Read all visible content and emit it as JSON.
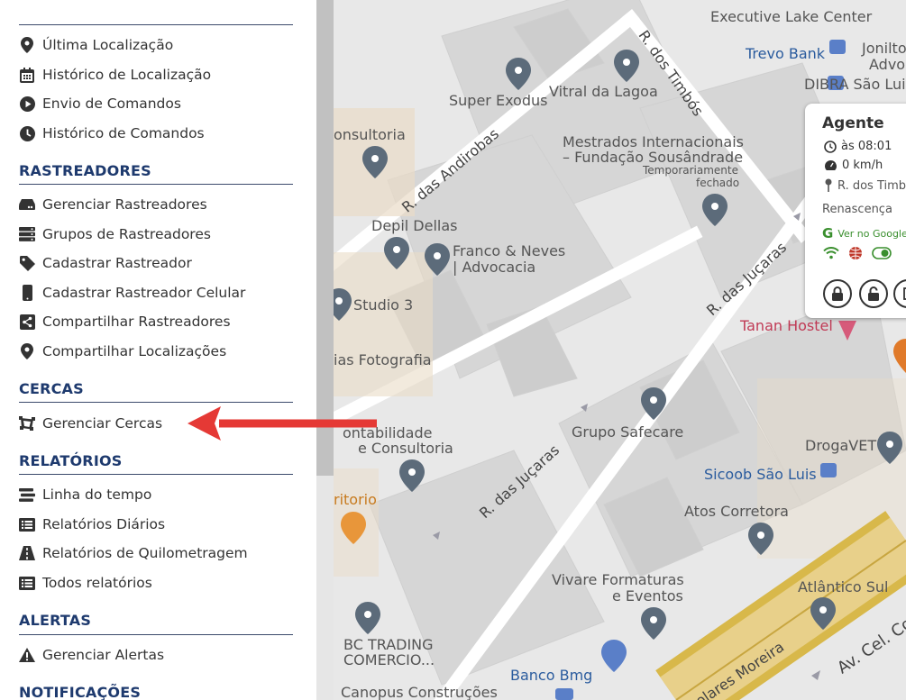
{
  "sidebar": {
    "top_items": [
      {
        "label": "Última Localização",
        "icon": "map-marker-icon"
      },
      {
        "label": "Histórico de Localização",
        "icon": "calendar-icon"
      },
      {
        "label": "Envio de Comandos",
        "icon": "play-circle-icon"
      },
      {
        "label": "Histórico de Comandos",
        "icon": "clock-icon"
      }
    ],
    "sections": [
      {
        "title": "RASTREADORES",
        "items": [
          {
            "label": "Gerenciar Rastreadores",
            "icon": "hdd-icon"
          },
          {
            "label": "Grupos de Rastreadores",
            "icon": "server-icon"
          },
          {
            "label": "Cadastrar Rastreador",
            "icon": "tag-icon"
          },
          {
            "label": "Cadastrar Rastreador Celular",
            "icon": "mobile-icon"
          },
          {
            "label": "Compartilhar Rastreadores",
            "icon": "share-icon"
          },
          {
            "label": "Compartilhar Localizações",
            "icon": "map-marker-icon"
          }
        ]
      },
      {
        "title": "CERCAS",
        "items": [
          {
            "label": "Gerenciar Cercas",
            "icon": "draw-polygon-icon"
          }
        ]
      },
      {
        "title": "RELATÓRIOS",
        "items": [
          {
            "label": "Linha do tempo",
            "icon": "stream-icon"
          },
          {
            "label": "Relatórios Diários",
            "icon": "list-alt-icon"
          },
          {
            "label": "Relatórios de Quilometragem",
            "icon": "road-icon"
          },
          {
            "label": "Todos relatórios",
            "icon": "list-alt-icon"
          }
        ]
      },
      {
        "title": "ALERTAS",
        "items": [
          {
            "label": "Gerenciar Alertas",
            "icon": "warning-icon"
          }
        ]
      },
      {
        "title": "NOTIFICAÇÕES",
        "items": []
      }
    ]
  },
  "map": {
    "places": [
      {
        "name": "Executive Lake Center",
        "style": "gray"
      },
      {
        "name": "Trevo Bank",
        "style": "blue"
      },
      {
        "name": "Jonilto",
        "style": "gray"
      },
      {
        "name": "Advog",
        "style": "gray"
      },
      {
        "name": "DIBRA São Luis",
        "style": "gray"
      },
      {
        "name": "Super Exodus",
        "style": "gray"
      },
      {
        "name": "Vitral da Lagoa",
        "style": "gray"
      },
      {
        "name": "onsultoria",
        "style": "gray"
      },
      {
        "name": "Mestrados Internacionais",
        "style": "gray"
      },
      {
        "name": "– Fundação Sousândrade",
        "style": "gray"
      },
      {
        "name": "Temporariamente",
        "style": "gray"
      },
      {
        "name": "fechado",
        "style": "gray"
      },
      {
        "name": "Depil Dellas",
        "style": "gray"
      },
      {
        "name": "Franco & Neves",
        "style": "gray"
      },
      {
        "name": "| Advocacia",
        "style": "gray"
      },
      {
        "name": "Studio 3",
        "style": "gray"
      },
      {
        "name": "ias Fotografia",
        "style": "gray"
      },
      {
        "name": "Tanan Hostel",
        "style": "red"
      },
      {
        "name": "ontabilidade",
        "style": "gray"
      },
      {
        "name": "e Consultoria",
        "style": "gray"
      },
      {
        "name": "Grupo Safecare",
        "style": "gray"
      },
      {
        "name": "DrogaVET",
        "style": "gray"
      },
      {
        "name": "Sicoob São Luis",
        "style": "blue"
      },
      {
        "name": "ritorio",
        "style": "orange"
      },
      {
        "name": "Atos Corretora",
        "style": "gray"
      },
      {
        "name": "Vivare Formaturas",
        "style": "gray"
      },
      {
        "name": "e Eventos",
        "style": "gray"
      },
      {
        "name": "Atlântico Sul",
        "style": "gray"
      },
      {
        "name": "BC TRADING",
        "style": "gray"
      },
      {
        "name": "COMERCIO...",
        "style": "gray"
      },
      {
        "name": "Banco Bmg",
        "style": "blue"
      },
      {
        "name": "Canopus Construções",
        "style": "gray"
      }
    ],
    "streets": [
      {
        "name": "R. dos Timbós"
      },
      {
        "name": "R. das Andirobas"
      },
      {
        "name": "R. das Juçaras"
      },
      {
        "name": "R. das Juçaras"
      },
      {
        "name": "olares Moreira"
      },
      {
        "name": "Av. Cel. Col"
      }
    ]
  },
  "popup": {
    "title": "Agente",
    "time": "às 08:01",
    "speed": "0 km/h",
    "address": "R. dos Timbó",
    "neighborhood": "Renascença",
    "google_link": "Ver no Google",
    "status_colors": {
      "wifi": "#3a8f2e",
      "globe": "#c0392b",
      "toggle": "#3a8f2e"
    }
  },
  "colors": {
    "section_title": "#1e3a6e",
    "arrow": "#e53935",
    "link_green": "#3a8f2e"
  }
}
